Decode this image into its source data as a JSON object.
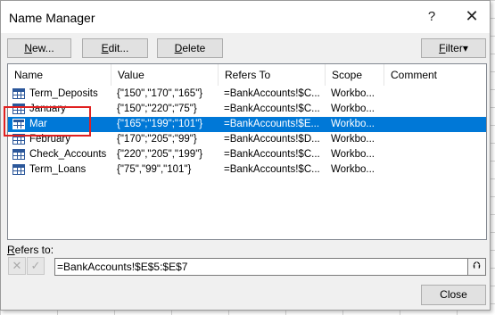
{
  "dialog": {
    "title": "Name Manager",
    "help_label": "?",
    "close_glyph": "✕"
  },
  "toolbar": {
    "new_label_u": "N",
    "new_label_rest": "ew...",
    "edit_label_u": "E",
    "edit_label_rest": "dit...",
    "delete_label_u": "D",
    "delete_label_rest": "elete",
    "filter_label_u": "F",
    "filter_label_rest": "ilter",
    "filter_arrow": "▾"
  },
  "table": {
    "columns": [
      "Name",
      "Value",
      "Refers To",
      "Scope",
      "Comment"
    ],
    "rows": [
      {
        "name": "Term_Deposits",
        "value": "{\"150\",\"170\",\"165\"}",
        "refers_to": "=BankAccounts!$C...",
        "scope": "Workbo...",
        "comment": "",
        "selected": false
      },
      {
        "name": "January",
        "value": "{\"150\";\"220\";\"75\"}",
        "refers_to": "=BankAccounts!$C...",
        "scope": "Workbo...",
        "comment": "",
        "selected": false
      },
      {
        "name": "Mar",
        "value": "{\"165\";\"199\";\"101\"}",
        "refers_to": "=BankAccounts!$E...",
        "scope": "Workbo...",
        "comment": "",
        "selected": true
      },
      {
        "name": "February",
        "value": "{\"170\";\"205\";\"99\"}",
        "refers_to": "=BankAccounts!$D...",
        "scope": "Workbo...",
        "comment": "",
        "selected": false
      },
      {
        "name": "Check_Accounts",
        "value": "{\"220\",\"205\",\"199\"}",
        "refers_to": "=BankAccounts!$C...",
        "scope": "Workbo...",
        "comment": "",
        "selected": false
      },
      {
        "name": "Term_Loans",
        "value": "{\"75\",\"99\",\"101\"}",
        "refers_to": "=BankAccounts!$C...",
        "scope": "Workbo...",
        "comment": "",
        "selected": false
      }
    ]
  },
  "refers": {
    "label_u": "R",
    "label_rest": "efers to:",
    "value": "=BankAccounts!$E$5:$E$7",
    "cancel_glyph": "✕",
    "confirm_glyph": "✓",
    "collapse_glyph": "⮉"
  },
  "footer": {
    "close_label": "Close"
  },
  "colors": {
    "selection": "#0078d7",
    "highlight_box": "#e02020"
  }
}
